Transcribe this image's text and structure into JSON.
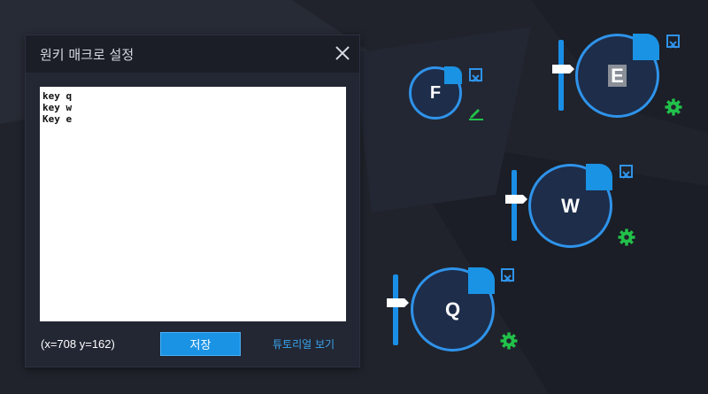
{
  "dialog": {
    "title": "원키 매크로 설정",
    "close_icon": "close-icon",
    "editor_text": "key q\nkey w\nKey e",
    "coords": "(x=708  y=162)",
    "save_label": "저장",
    "tutorial_label": "튜토리얼 보기"
  },
  "keys": {
    "f": {
      "label": "F",
      "icon": "pencil-icon"
    },
    "e": {
      "label": "E",
      "icon": "gear-icon"
    },
    "w": {
      "label": "W",
      "icon": "gear-icon"
    },
    "q": {
      "label": "Q",
      "icon": "gear-icon"
    }
  },
  "colors": {
    "accent": "#1a93e5",
    "keycap_fill": "#1d2d4a",
    "gear": "#22c14a",
    "background": "#20232b"
  }
}
